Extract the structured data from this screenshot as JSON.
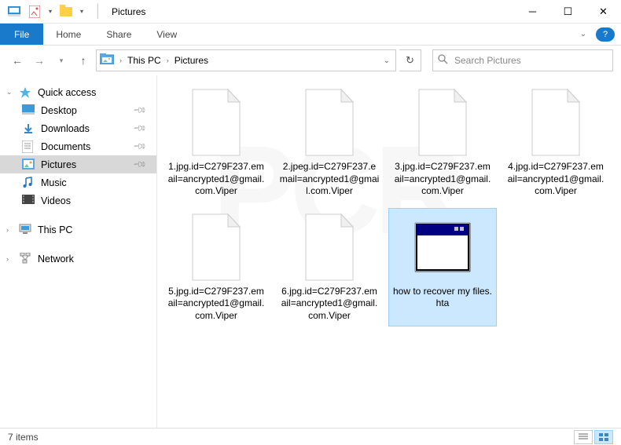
{
  "titlebar": {
    "title": "Pictures"
  },
  "ribbon": {
    "file": "File",
    "tabs": [
      "Home",
      "Share",
      "View"
    ]
  },
  "breadcrumb": {
    "segments": [
      "This PC",
      "Pictures"
    ]
  },
  "search": {
    "placeholder": "Search Pictures"
  },
  "sidebar": {
    "quick_access": {
      "label": "Quick access",
      "items": [
        {
          "label": "Desktop",
          "icon": "desktop",
          "pinned": true
        },
        {
          "label": "Downloads",
          "icon": "downloads",
          "pinned": true
        },
        {
          "label": "Documents",
          "icon": "documents",
          "pinned": true
        },
        {
          "label": "Pictures",
          "icon": "pictures",
          "pinned": true,
          "selected": true
        },
        {
          "label": "Music",
          "icon": "music",
          "pinned": false
        },
        {
          "label": "Videos",
          "icon": "videos",
          "pinned": false
        }
      ]
    },
    "this_pc": {
      "label": "This PC"
    },
    "network": {
      "label": "Network"
    }
  },
  "files": [
    {
      "name": "1.jpg.id=C279F237.email=ancrypted1@gmail.com.Viper",
      "type": "blank"
    },
    {
      "name": "2.jpeg.id=C279F237.email=ancrypted1@gmail.com.Viper",
      "type": "blank"
    },
    {
      "name": "3.jpg.id=C279F237.email=ancrypted1@gmail.com.Viper",
      "type": "blank"
    },
    {
      "name": "4.jpg.id=C279F237.email=ancrypted1@gmail.com.Viper",
      "type": "blank"
    },
    {
      "name": "5.jpg.id=C279F237.email=ancrypted1@gmail.com.Viper",
      "type": "blank"
    },
    {
      "name": "6.jpg.id=C279F237.email=ancrypted1@gmail.com.Viper",
      "type": "blank"
    },
    {
      "name": "how to recover my files.hta",
      "type": "hta",
      "selected": true
    }
  ],
  "statusbar": {
    "count": "7 items"
  }
}
